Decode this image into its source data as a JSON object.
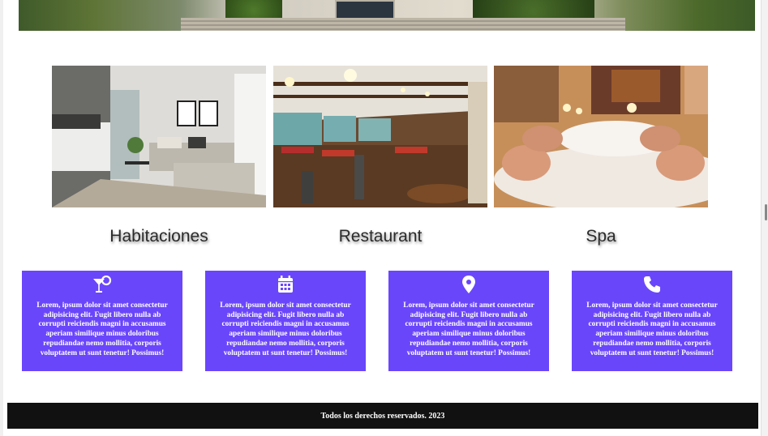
{
  "categories": [
    {
      "title": "Habitaciones",
      "photo_icon": "bedroom-photo"
    },
    {
      "title": "Restaurant",
      "photo_icon": "restaurant-photo"
    },
    {
      "title": "Spa",
      "photo_icon": "spa-photo"
    }
  ],
  "features": [
    {
      "icon": "cocktail-icon",
      "text": "Lorem, ipsum dolor sit amet consectetur adipisicing elit. Fugit libero nulla ab corrupti reiciendis magni in accusamus aperiam similique minus doloribus repudiandae nemo mollitia, corporis voluptatem ut sunt tenetur! Possimus!"
    },
    {
      "icon": "calendar-icon",
      "text": "Lorem, ipsum dolor sit amet consectetur adipisicing elit. Fugit libero nulla ab corrupti reiciendis magni in accusamus aperiam similique minus doloribus repudiandae nemo mollitia, corporis voluptatem ut sunt tenetur! Possimus!"
    },
    {
      "icon": "map-pin-icon",
      "text": "Lorem, ipsum dolor sit amet consectetur adipisicing elit. Fugit libero nulla ab corrupti reiciendis magni in accusamus aperiam similique minus doloribus repudiandae nemo mollitia, corporis voluptatem ut sunt tenetur! Possimus!"
    },
    {
      "icon": "phone-icon",
      "text": "Lorem, ipsum dolor sit amet consectetur adipisicing elit. Fugit libero nulla ab corrupti reiciendis magni in accusamus aperiam similique minus doloribus repudiandae nemo mollitia, corporis voluptatem ut sunt tenetur! Possimus!"
    }
  ],
  "footer": {
    "text": "Todos los derechos reservados. 2023"
  },
  "colors": {
    "feature_bg": "#6a46fb",
    "footer_bg": "#111111",
    "caption": "#2b2b2b"
  }
}
